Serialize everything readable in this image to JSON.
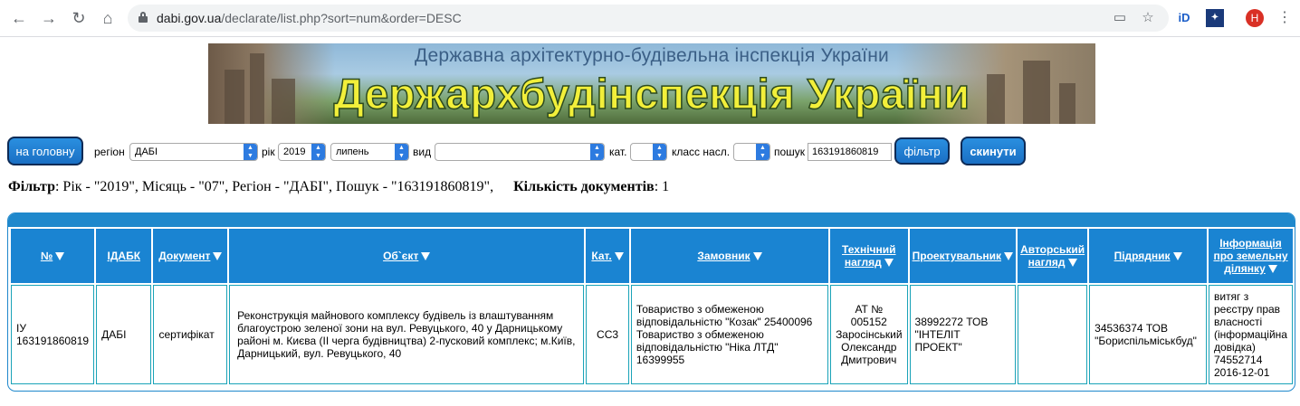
{
  "browser": {
    "url_host": "dabi.gov.ua",
    "url_path": "/declarate/list.php?sort=num&order=DESC",
    "profile_initial": "H",
    "ext1": "iD"
  },
  "banner": {
    "subtitle": "Державна архітектурно-будівельна інспекція України",
    "title": "Держархбудінспекція України"
  },
  "filters": {
    "home_button": "на головну",
    "region_label": "регіон",
    "region_value": "ДАБІ",
    "year_label": "рік",
    "year_value": "2019",
    "month_value": "липень",
    "kind_label": "вид",
    "kind_value": "",
    "cat_label": "кат.",
    "cat_value": "",
    "class_label": "класс насл.",
    "class_value": "",
    "search_label": "пошук",
    "search_value": "163191860819",
    "filter_button": "фільтр",
    "reset_button": "скинути"
  },
  "summary": {
    "filter_label": "Фільтр",
    "filter_text": ": Рік - \"2019\", Місяць - \"07\", Регіон - \"ДАБІ\", Пошук - \"163191860819\",",
    "count_label": "Кількість документів",
    "count_value": ": 1"
  },
  "table": {
    "headers": {
      "num": "№",
      "idabk": "ІДАБК",
      "doc": "Документ",
      "object": "Об`єкт",
      "cat": "Кат.",
      "customer": "Замовник",
      "tech_line1": "Технічний",
      "tech_line2": "нагляд",
      "designer": "Проектувальник",
      "author_line1": "Авторський",
      "author_line2": "нагляд",
      "contractor": "Підрядник",
      "land_line1": "Інформація",
      "land_line2": "про земельну",
      "land_line3": "ділянку"
    },
    "row": {
      "num_line1": "ІУ",
      "num_line2": "163191860819",
      "idabk": "ДАБІ",
      "doc": "сертифікат",
      "object": "Реконструкція майнового комплексу будівель із влаштуванням благоустрою зеленої зони на вул. Ревуцького, 40 у Дарницькому районі м. Києва (ІІ черга будівництва) 2-пусковий комплекс; м.Київ, Дарницький, вул. Ревуцького, 40",
      "cat": "СС3",
      "customer": "Товариство з обмеженою відповідальністю \"Козак\" 25400096 Товариство з обмеженою відповідальністю \"Ніка ЛТД\" 16399955",
      "tech": "АТ № 005152 Заросінський Олександр Дмитрович",
      "designer": "38992272 ТОВ \"ІНТЕЛІТ ПРОЕКТ\"",
      "author": "",
      "contractor": "34536374 ТОВ \"Бориспільміськбуд\"",
      "land": "витяг з реєстру прав власності (інформаційна довідка) 74552714 2016-12-01"
    }
  }
}
